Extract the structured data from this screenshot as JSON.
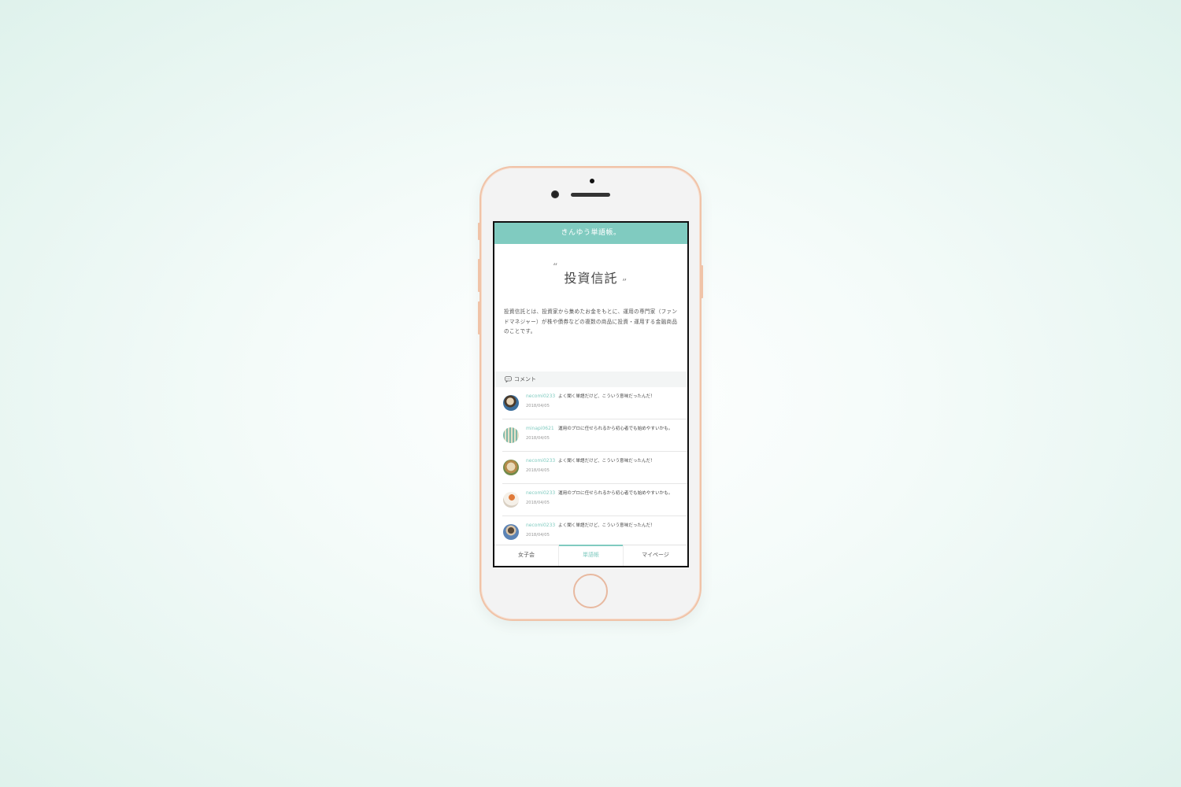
{
  "app": {
    "title": "きんゆう単語帳。"
  },
  "term": {
    "title": "投資信託",
    "quote_open": "“",
    "quote_close": "”",
    "definition": "投資信託とは、投資家から集めたお金をもとに、運用の専門家（ファンドマネジャー）が株や債券などの複数の商品に投資・運用する金融商品のことです。"
  },
  "comments_section": {
    "label": "コメント",
    "icon": "speech-bubble-icon",
    "items": [
      {
        "user": "necomi0233",
        "text": "よく聞く単語だけど、こういう意味だったんだ！",
        "date": "2018/04/05"
      },
      {
        "user": "minapi0621",
        "text": "運用のプロに任せられるから初心者でも始めやすいかも。",
        "date": "2018/04/05"
      },
      {
        "user": "necomi0233",
        "text": "よく聞く単語だけど、こういう意味だったんだ！",
        "date": "2018/04/05"
      },
      {
        "user": "necomi0233",
        "text": "運用のプロに任せられるから初心者でも始めやすいかも。",
        "date": "2018/04/05"
      },
      {
        "user": "necomi0233",
        "text": "よく聞く単語だけど、こういう意味だったんだ！",
        "date": "2018/04/05"
      }
    ]
  },
  "tabs": [
    {
      "label": "女子会",
      "active": false
    },
    {
      "label": "単語帳",
      "active": true
    },
    {
      "label": "マイページ",
      "active": false
    }
  ],
  "colors": {
    "accent": "#80cbc0",
    "phone_frame": "#f0c3a8",
    "background": "#e3f4ee"
  }
}
